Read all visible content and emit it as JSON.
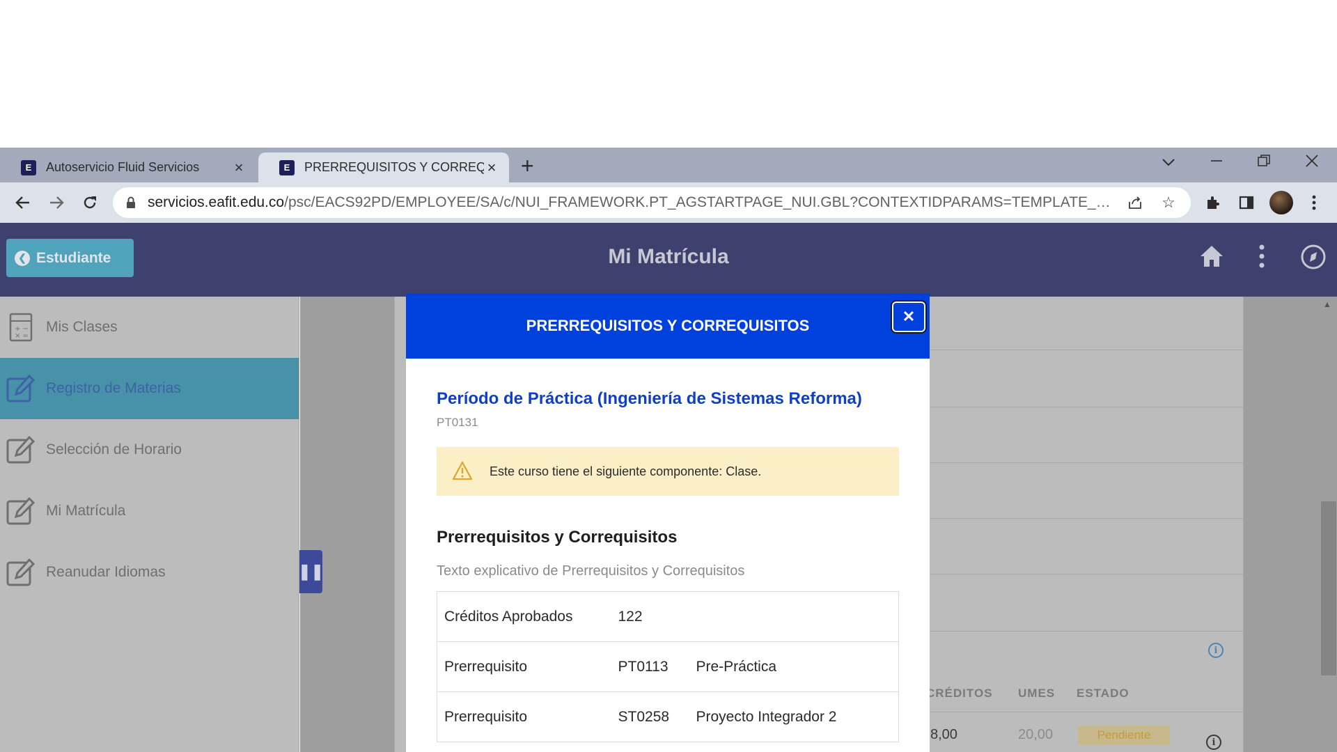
{
  "browser": {
    "tabs": [
      {
        "title": "Autoservicio Fluid Servicios",
        "favicon": "E",
        "active": false
      },
      {
        "title": "PRERREQUISITOS Y CORREQUISITOS",
        "favicon": "E",
        "active": true
      }
    ],
    "new_tab_icon": "plus-icon",
    "url_host": "servicios.eafit.edu.co",
    "url_path": "/psc/EACS92PD/EMPLOYEE/SA/c/NUI_FRAMEWORK.PT_AGSTARTPAGE_NUI.GBL?CONTEXTIDPARAMS=TEMPLATE_ID%3aPTPPNA..."
  },
  "app": {
    "back_label": "Estudiante",
    "title": "Mi Matrícula",
    "header_color": "#3e406e",
    "accent_color": "#4fa3bb"
  },
  "sidebar": {
    "items": [
      {
        "label": "Mis Clases",
        "icon": "calculator-icon",
        "active": false
      },
      {
        "label": "Registro de Materias",
        "icon": "edit-icon",
        "active": true
      },
      {
        "label": "Selección de Horario",
        "icon": "edit-icon",
        "active": false
      },
      {
        "label": "Mi Matrícula",
        "icon": "edit-icon",
        "active": false
      },
      {
        "label": "Reanudar Idiomas",
        "icon": "edit-icon",
        "active": false
      }
    ]
  },
  "background_table": {
    "headers": [
      "CRÉDITOS",
      "UMES",
      "ESTADO"
    ],
    "row": {
      "creditos": "8,00",
      "umes": "20,00",
      "estado": "Pendiente"
    }
  },
  "modal": {
    "title": "PRERREQUISITOS Y CORREQUISITOS",
    "header_color": "#0040dd",
    "course_title": "Período de Práctica (Ingeniería de Sistemas Reforma)",
    "course_code": "PT0131",
    "alert_text": "Este curso tiene el siguiente componente: Clase.",
    "section_title": "Prerrequisitos y Correquisitos",
    "section_desc": "Texto explicativo de Prerrequisitos y Correquisitos",
    "rows": [
      {
        "type": "Créditos Aprobados",
        "code": "122",
        "name": ""
      },
      {
        "type": "Prerrequisito",
        "code": "PT0113",
        "name": "Pre-Práctica"
      },
      {
        "type": "Prerrequisito",
        "code": "ST0258",
        "name": "Proyecto Integrador 2"
      }
    ]
  }
}
